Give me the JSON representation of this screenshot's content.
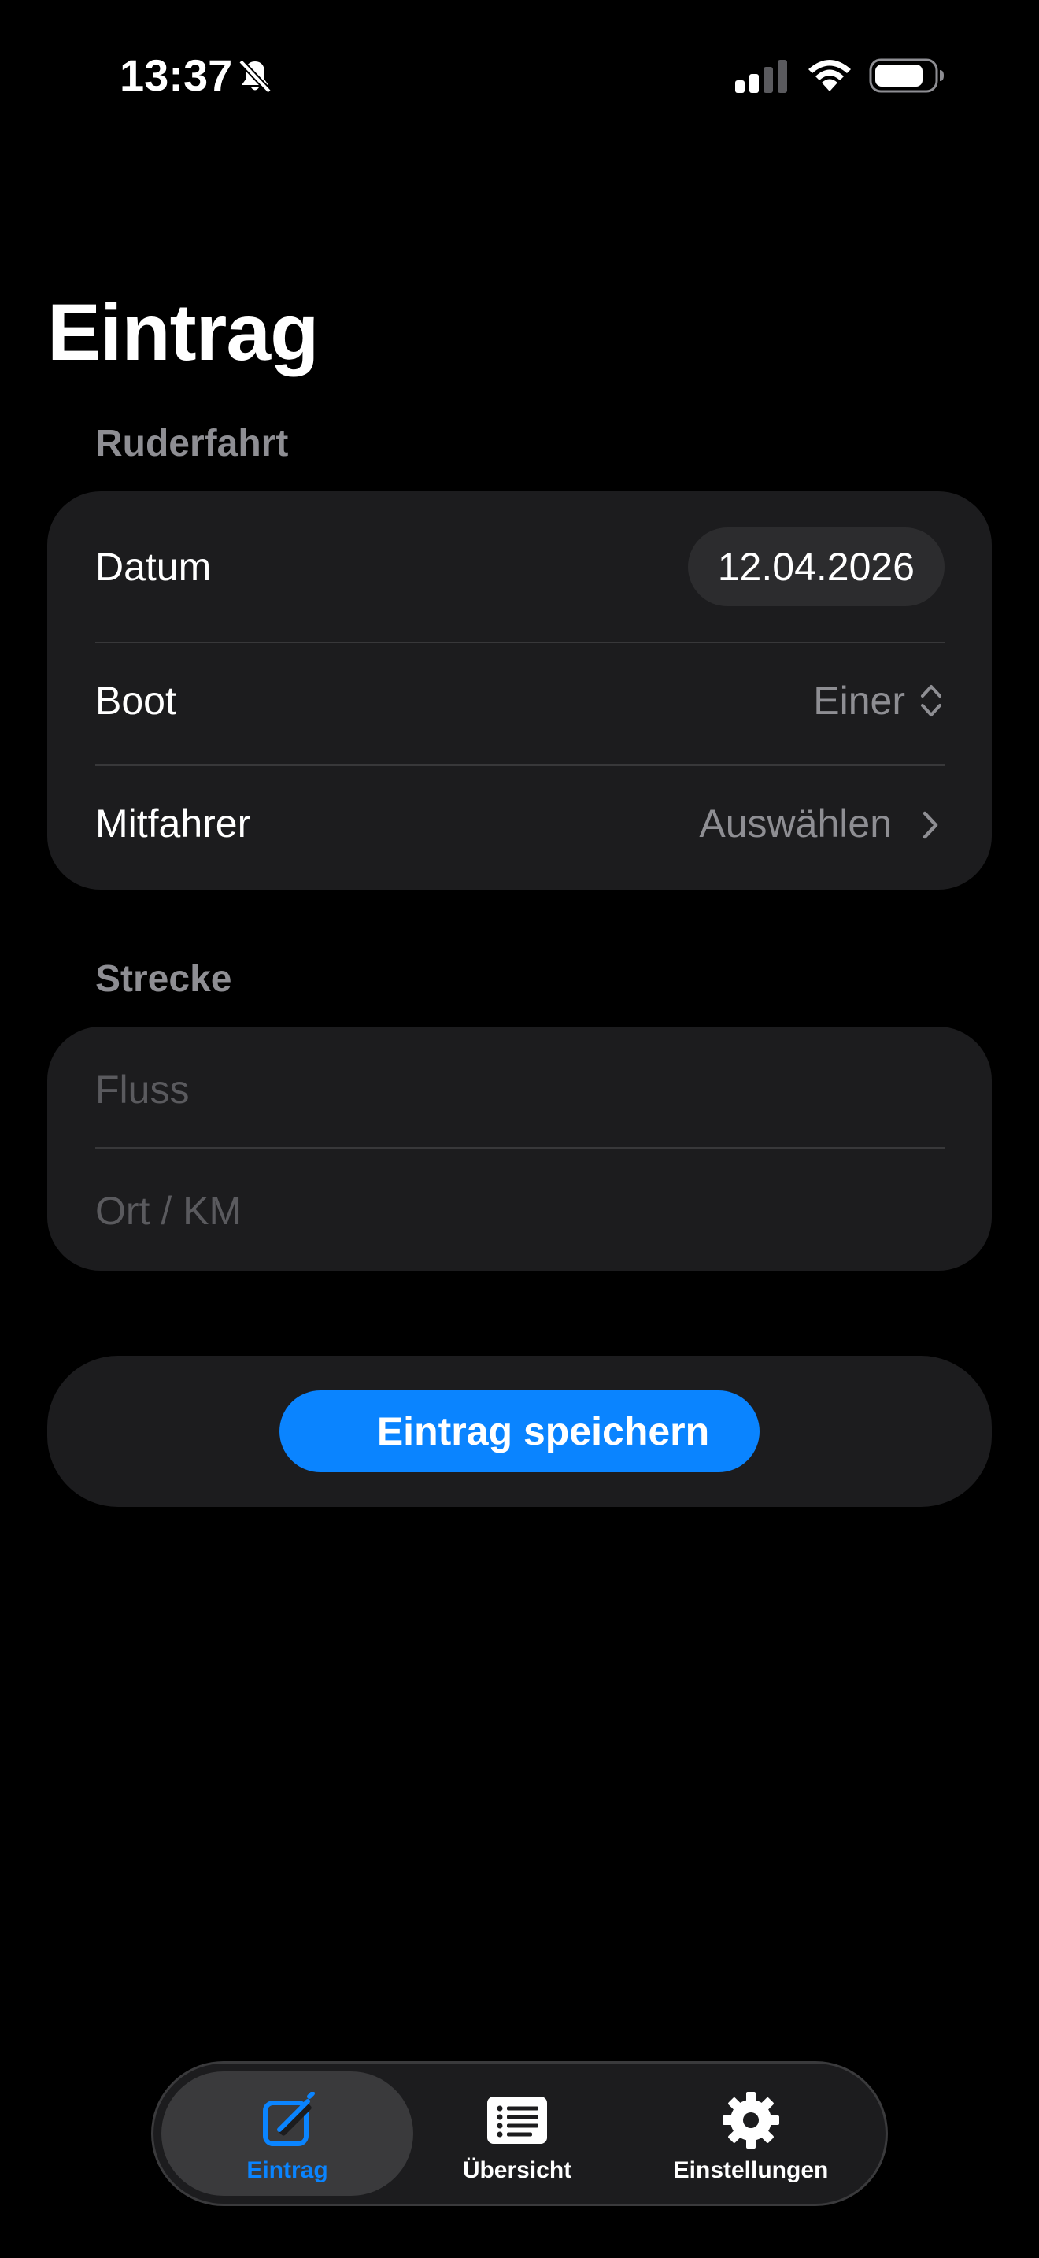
{
  "status_bar": {
    "time": "13:37"
  },
  "page": {
    "title": "Eintrag"
  },
  "ruderfahrt": {
    "header": "Ruderfahrt",
    "datum_label": "Datum",
    "datum_value": "12.04.2026",
    "boot_label": "Boot",
    "boot_value": "Einer",
    "mitfahrer_label": "Mitfahrer",
    "mitfahrer_value": "Auswählen"
  },
  "strecke": {
    "header": "Strecke",
    "fluss_placeholder": "Fluss",
    "ort_placeholder": "Ort / KM"
  },
  "actions": {
    "save_label": "Eintrag speichern"
  },
  "tab_bar": {
    "tabs": [
      {
        "label": "Eintrag",
        "icon": "compose-icon",
        "active": true
      },
      {
        "label": "Übersicht",
        "icon": "list-icon",
        "active": false
      },
      {
        "label": "Einstellungen",
        "icon": "gear-icon",
        "active": false
      }
    ]
  },
  "colors": {
    "accent": "#0a84ff",
    "background": "#000000",
    "card": "#1c1c1e",
    "secondary_text": "#8e8e93"
  }
}
